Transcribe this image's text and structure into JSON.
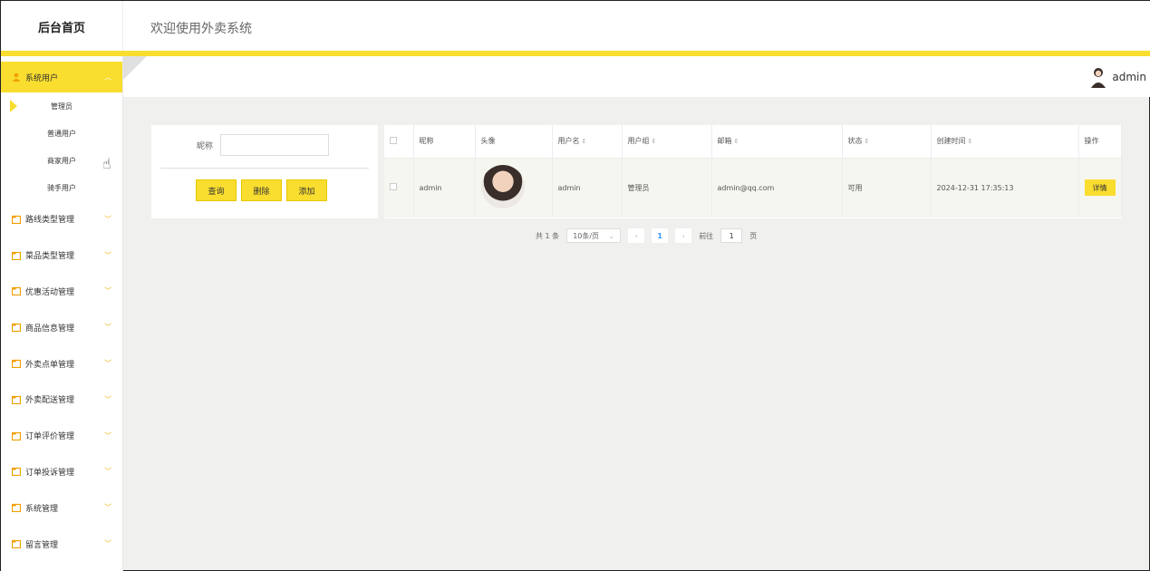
{
  "header": {
    "brand": "后台首页",
    "welcome": "欢迎使用外卖系统",
    "username": "admin"
  },
  "colors": {
    "accent": "#f9dd2f",
    "chevron": "#f0b000",
    "link": "#3399ff"
  },
  "sidebar": {
    "active_group": "系统用户",
    "subitems": [
      "管理员",
      "普通用户",
      "商家用户",
      "骑手用户"
    ],
    "groups": [
      "路线类型管理",
      "菜品类型管理",
      "优惠活动管理",
      "商品信息管理",
      "外卖点单管理",
      "外卖配送管理",
      "订单评价管理",
      "订单投诉管理",
      "系统管理",
      "留言管理"
    ]
  },
  "search": {
    "label": "昵称",
    "placeholder": "",
    "buttons": {
      "query": "查询",
      "delete": "删除",
      "add": "添加"
    }
  },
  "table": {
    "headers": {
      "nickname": "昵称",
      "avatar": "头像",
      "username": "用户名",
      "group": "用户组",
      "email": "邮箱",
      "status": "状态",
      "created": "创建时间",
      "action": "操作"
    },
    "rows": [
      {
        "nickname": "admin",
        "username": "admin",
        "group": "管理员",
        "email": "admin@qq.com",
        "status": "可用",
        "created": "2024-12-31 17:35:13",
        "action": "详情"
      }
    ]
  },
  "pagination": {
    "total": "共 1 条",
    "page_size": "10条/页",
    "current": "1",
    "goto_label": "前往",
    "goto_value": "1",
    "page_suffix": "页"
  }
}
